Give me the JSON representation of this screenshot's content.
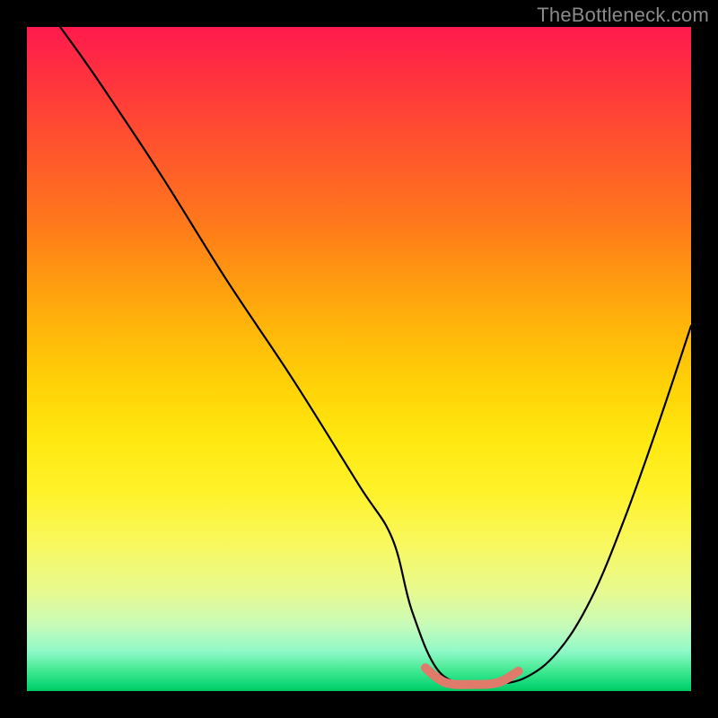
{
  "header": {
    "watermark": "TheBottleneck.com"
  },
  "colors": {
    "frame": "#000000",
    "watermark": "#8a8a8a",
    "curve": "#000000",
    "accent_segment": "#e07a6a",
    "gradient_top": "#ff1a4d",
    "gradient_bottom": "#00c860"
  },
  "chart_data": {
    "type": "line",
    "title": "",
    "xlabel": "",
    "ylabel": "",
    "xlim": [
      0,
      100
    ],
    "ylim": [
      0,
      100
    ],
    "grid": false,
    "legend": false,
    "annotations": [],
    "series": [
      {
        "name": "main-curve",
        "stroke": "#000000",
        "x": [
          5,
          10,
          20,
          30,
          40,
          50,
          55,
          58,
          62,
          67,
          70,
          75,
          80,
          85,
          90,
          95,
          100
        ],
        "y": [
          100,
          93,
          78,
          62,
          47,
          31,
          23,
          12,
          3,
          1,
          1,
          2,
          6,
          14,
          26,
          40,
          55
        ]
      },
      {
        "name": "optimal-range",
        "stroke": "#e07a6a",
        "x": [
          60,
          63,
          67,
          71,
          74
        ],
        "y": [
          3.5,
          1.3,
          1.0,
          1.3,
          3.0
        ]
      }
    ]
  }
}
